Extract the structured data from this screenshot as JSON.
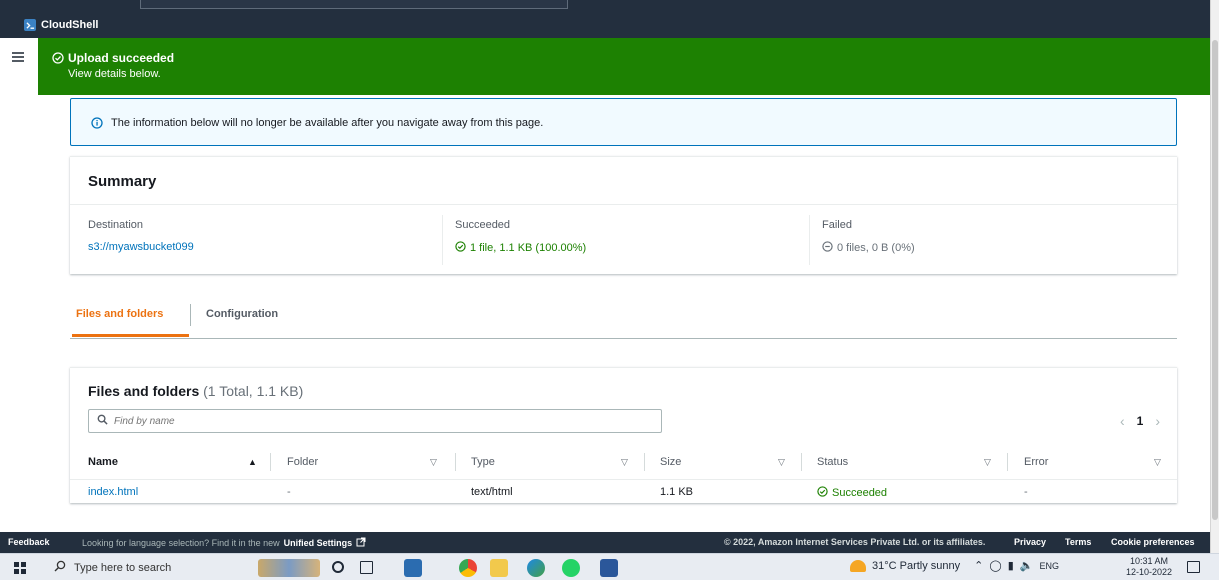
{
  "header": {
    "app_name": "CloudShell"
  },
  "flash": {
    "title": "Upload succeeded",
    "subtitle": "View details below."
  },
  "info": {
    "text": "The information below will no longer be available after you navigate away from this page."
  },
  "summary": {
    "title": "Summary",
    "destination_label": "Destination",
    "destination_value": "s3://myawsbucket099",
    "succeeded_label": "Succeeded",
    "succeeded_value": "1 file, 1.1 KB (100.00%)",
    "failed_label": "Failed",
    "failed_value": "0 files, 0 B (0%)"
  },
  "tabs": [
    {
      "label": "Files and folders"
    },
    {
      "label": "Configuration"
    }
  ],
  "files": {
    "title": "Files and folders",
    "count": "(1 Total, 1.1 KB)",
    "search_placeholder": "Find by name",
    "page_number": "1",
    "columns": [
      "Name",
      "Folder",
      "Type",
      "Size",
      "Status",
      "Error"
    ],
    "rows": [
      {
        "name": "index.html",
        "folder": "-",
        "type": "text/html",
        "size": "1.1 KB",
        "status": "Succeeded",
        "error": "-"
      }
    ]
  },
  "footer": {
    "feedback": "Feedback",
    "language_msg": "Looking for language selection? Find it in the new",
    "unified_settings": "Unified Settings",
    "copyright": "© 2022, Amazon Internet Services Private Ltd. or its affiliates.",
    "privacy": "Privacy",
    "terms": "Terms",
    "cookies": "Cookie preferences"
  },
  "taskbar": {
    "search_placeholder": "Type here to search",
    "weather": "31°C  Partly sunny",
    "lang": "ENG",
    "time": "10:31 AM",
    "date": "12-10-2022"
  },
  "colors": {
    "success": "#1d8102",
    "link": "#0073bb",
    "accent": "#ec7211",
    "navy": "#232f3e"
  }
}
